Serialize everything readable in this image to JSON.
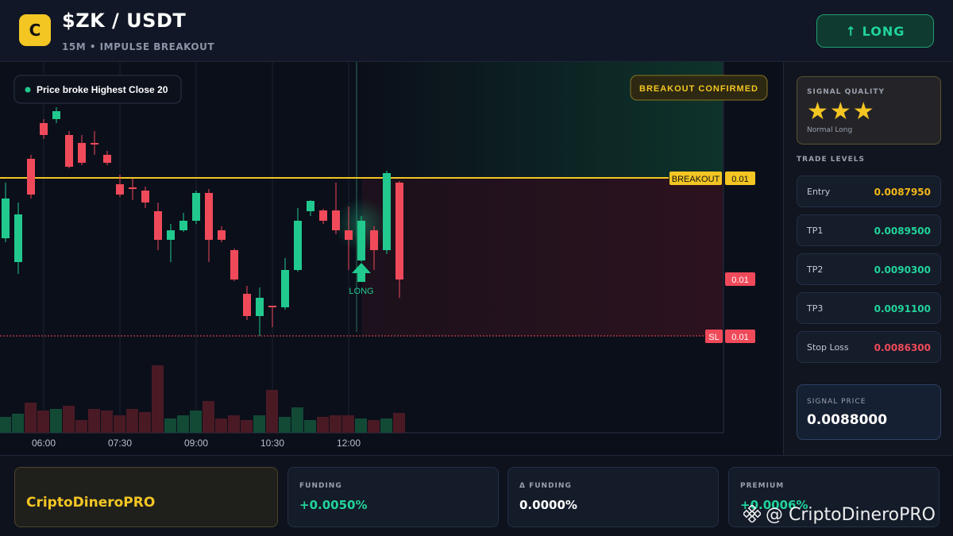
{
  "header": {
    "logo_letter": "C",
    "pair": "$ZK / USDT",
    "subtitle": "15M • IMPULSE BREAKOUT",
    "signal_button": "↑ LONG"
  },
  "chart": {
    "note": "Price broke Highest Close 20",
    "badge": "BREAKOUT CONFIRMED",
    "breakout_label": "BREAKOUT",
    "breakout_price": "0.01",
    "last_price": "0.01",
    "sl_label": "SL",
    "sl_price": "0.01",
    "long_marker": "LONG",
    "tv_logo": "TV"
  },
  "chart_data": {
    "type": "candlestick",
    "time_labels": [
      "06:00",
      "07:30",
      "09:00",
      "10:30",
      "12:00"
    ],
    "candles": [
      {
        "o": 300,
        "c": 250,
        "h": 230,
        "l": 305,
        "v": 20
      },
      {
        "o": 330,
        "c": 270,
        "h": 255,
        "l": 345,
        "v": 24
      },
      {
        "o": 200,
        "c": 245,
        "h": 195,
        "l": 250,
        "v": 38
      },
      {
        "o": 155,
        "c": 170,
        "h": 150,
        "l": 175,
        "v": 28
      },
      {
        "o": 150,
        "c": 140,
        "h": 135,
        "l": 155,
        "v": 30
      },
      {
        "o": 170,
        "c": 210,
        "h": 165,
        "l": 212,
        "v": 34
      },
      {
        "o": 180,
        "c": 205,
        "h": 170,
        "l": 208,
        "v": 16
      },
      {
        "o": 180,
        "c": 182,
        "h": 165,
        "l": 195,
        "v": 30
      },
      {
        "o": 195,
        "c": 205,
        "h": 190,
        "l": 208,
        "v": 28
      },
      {
        "o": 232,
        "c": 245,
        "h": 220,
        "l": 248,
        "v": 22
      },
      {
        "o": 236,
        "c": 238,
        "h": 225,
        "l": 252,
        "v": 30
      },
      {
        "o": 240,
        "c": 255,
        "h": 235,
        "l": 262,
        "v": 26
      },
      {
        "o": 266,
        "c": 302,
        "h": 255,
        "l": 315,
        "v": 85
      },
      {
        "o": 302,
        "c": 290,
        "h": 282,
        "l": 330,
        "v": 18
      },
      {
        "o": 290,
        "c": 278,
        "h": 268,
        "l": 292,
        "v": 22
      },
      {
        "o": 278,
        "c": 243,
        "h": 240,
        "l": 282,
        "v": 28
      },
      {
        "o": 243,
        "c": 302,
        "h": 238,
        "l": 330,
        "v": 40
      },
      {
        "o": 290,
        "c": 302,
        "h": 285,
        "l": 305,
        "v": 18
      },
      {
        "o": 315,
        "c": 352,
        "h": 313,
        "l": 354,
        "v": 22
      },
      {
        "o": 370,
        "c": 398,
        "h": 360,
        "l": 403,
        "v": 16
      },
      {
        "o": 398,
        "c": 375,
        "h": 362,
        "l": 423,
        "v": 22
      },
      {
        "o": 385,
        "c": 387,
        "h": 385,
        "l": 412,
        "v": 54
      },
      {
        "o": 387,
        "c": 340,
        "h": 325,
        "l": 390,
        "v": 20
      },
      {
        "o": 340,
        "c": 278,
        "h": 262,
        "l": 342,
        "v": 32
      },
      {
        "o": 266,
        "c": 253,
        "h": 252,
        "l": 272,
        "v": 16
      },
      {
        "o": 265,
        "c": 278,
        "h": 263,
        "l": 282,
        "v": 20
      },
      {
        "o": 265,
        "c": 290,
        "h": 230,
        "l": 295,
        "v": 22
      },
      {
        "o": 290,
        "c": 302,
        "h": 260,
        "l": 340,
        "v": 22
      },
      {
        "o": 328,
        "c": 278,
        "h": 272,
        "l": 330,
        "v": 18
      },
      {
        "o": 290,
        "c": 315,
        "h": 285,
        "l": 340,
        "v": 16
      },
      {
        "o": 315,
        "c": 218,
        "h": 215,
        "l": 320,
        "v": 18
      },
      {
        "o": 230,
        "c": 352,
        "h": 228,
        "l": 375,
        "v": 25
      }
    ]
  },
  "sidebar": {
    "quality_label": "SIGNAL QUALITY",
    "stars": "★★★",
    "quality_sub": "Normal Long",
    "levels_title": "TRADE LEVELS",
    "levels": [
      {
        "name": "Entry",
        "value": "0.0087950",
        "color": "#f3b817"
      },
      {
        "name": "TP1",
        "value": "0.0089500",
        "color": "#21d49a"
      },
      {
        "name": "TP2",
        "value": "0.0090300",
        "color": "#21d49a"
      },
      {
        "name": "TP3",
        "value": "0.0091100",
        "color": "#21d49a"
      },
      {
        "name": "Stop Loss",
        "value": "0.0086300",
        "color": "#f04a5a"
      }
    ],
    "signal_price_label": "SIGNAL PRICE",
    "signal_price": "0.0088000"
  },
  "footer": {
    "brand": "CriptoDineroPRO",
    "stats": [
      {
        "label": "FUNDING",
        "value": "+0.0050%",
        "color": "#21d49a"
      },
      {
        "label": "Δ FUNDING",
        "value": "0.0000%",
        "color": "#ffffff"
      },
      {
        "label": "PREMIUM",
        "value": "+0.0006%",
        "color": "#21d49a"
      }
    ],
    "watermark": "@ CriptoDineroPRO"
  },
  "colors": {
    "up": "#21c98e",
    "down": "#f04a5a",
    "accent": "#f3c623"
  }
}
